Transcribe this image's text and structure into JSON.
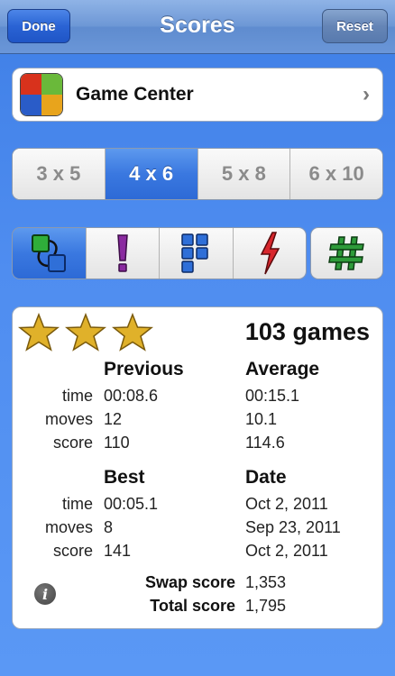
{
  "nav": {
    "title": "Scores",
    "done_label": "Done",
    "reset_label": "Reset"
  },
  "game_center": {
    "label": "Game Center",
    "chevron": "›",
    "icon": "game-center-icon"
  },
  "sizes": {
    "items": [
      "3 x 5",
      "4 x 6",
      "5 x 8",
      "6 x 10"
    ],
    "selected": "4 x 6"
  },
  "modes": {
    "items": [
      "swap-mode-icon",
      "exclamation-mode-icon",
      "blocks-mode-icon",
      "lightning-mode-icon"
    ],
    "selected": "swap-mode-icon",
    "hash_button": "#"
  },
  "stats": {
    "stars": 3,
    "games": "103 games",
    "previous": {
      "header": "Previous",
      "time": "00:08.6",
      "moves": "12",
      "score": "110"
    },
    "average": {
      "header": "Average",
      "time": "00:15.1",
      "moves": "10.1",
      "score": "114.6"
    },
    "best": {
      "header": "Best",
      "time": "00:05.1",
      "moves": "8",
      "score": "141"
    },
    "date": {
      "header": "Date",
      "time": "Oct 2, 2011",
      "moves": "Sep 23, 2011",
      "score": "Oct 2, 2011"
    },
    "labels": {
      "time": "time",
      "moves": "moves",
      "score": "score"
    },
    "swap_score_label": "Swap score",
    "swap_score": "1,353",
    "total_score_label": "Total score",
    "total_score": "1,795",
    "info": "i"
  },
  "colors": {
    "background": "#4f8df0",
    "selected_segment": "#3a78e0",
    "star": "#e0b12a",
    "hash": "#2e9b3a",
    "exclamation": "#8a2aa0",
    "blocks": "#2f6fd8",
    "lightning": "#d8262c"
  }
}
